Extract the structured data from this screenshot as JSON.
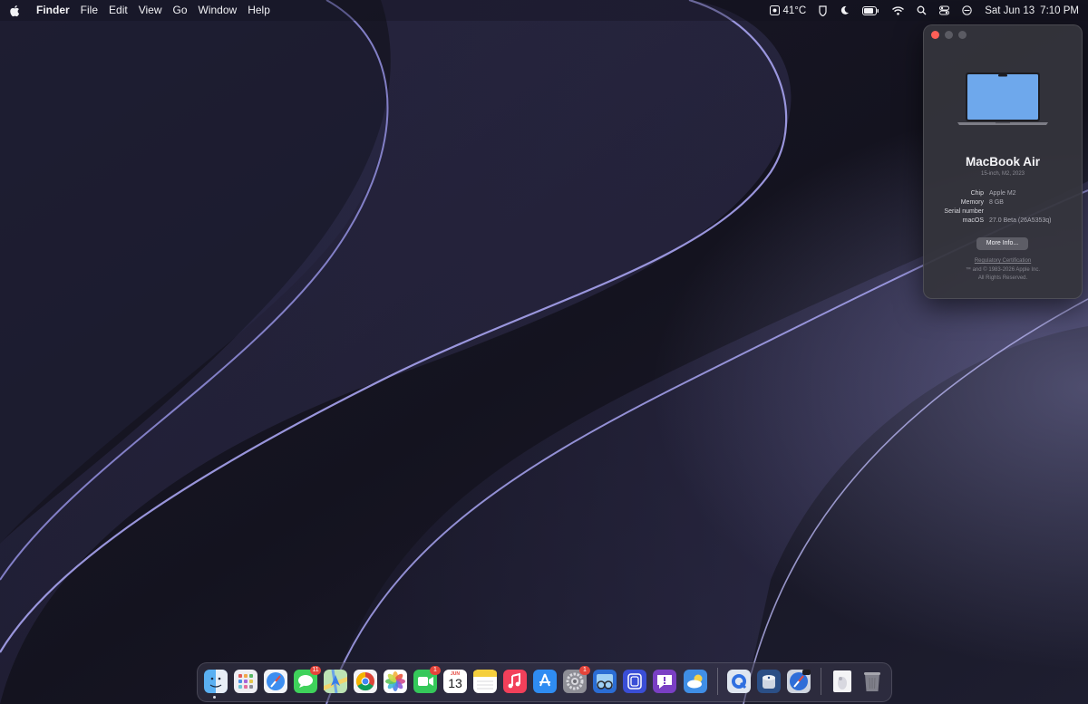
{
  "menubar": {
    "apple_icon": "apple-logo-icon",
    "items": [
      "Finder",
      "File",
      "Edit",
      "View",
      "Go",
      "Window",
      "Help"
    ],
    "weather": "41°C",
    "date": "Sat Jun 13",
    "time": "7:10 PM",
    "status_icons": [
      "weather-icon",
      "battery-shield-icon",
      "moon-icon",
      "battery-icon",
      "wifi-icon",
      "search-icon",
      "control-center-icon",
      "user-switch-icon"
    ]
  },
  "about": {
    "product_name": "MacBook Air",
    "product_subtitle": "15-inch, M2, 2023",
    "specs": [
      {
        "label": "Chip",
        "value": "Apple M2"
      },
      {
        "label": "Memory",
        "value": "8 GB"
      },
      {
        "label": "Serial number",
        "value": ""
      },
      {
        "label": "macOS",
        "value": "27.0 Beta (26A5353q)"
      }
    ],
    "more_info_label": "More Info...",
    "regulatory_link": "Regulatory Certification",
    "copyright_line1": "™ and © 1983-2026 Apple Inc.",
    "copyright_line2": "All Rights Reserved."
  },
  "dock": {
    "apps": [
      {
        "name": "finder-icon",
        "badge": ""
      },
      {
        "name": "launchpad-icon",
        "badge": ""
      },
      {
        "name": "safari-icon",
        "badge": ""
      },
      {
        "name": "messages-icon",
        "badge": "11"
      },
      {
        "name": "maps-icon",
        "badge": ""
      },
      {
        "name": "chrome-icon",
        "badge": ""
      },
      {
        "name": "photos-icon",
        "badge": ""
      },
      {
        "name": "facetime-icon",
        "badge": "1"
      },
      {
        "name": "calendar-icon",
        "badge": "",
        "day": "13",
        "month": "JUN"
      },
      {
        "name": "notes-icon",
        "badge": ""
      },
      {
        "name": "music-icon",
        "badge": ""
      },
      {
        "name": "app-store-icon",
        "badge": ""
      },
      {
        "name": "system-settings-icon",
        "badge": "1"
      },
      {
        "name": "preview-icon",
        "badge": ""
      },
      {
        "name": "screen-time-icon",
        "badge": ""
      },
      {
        "name": "feedback-icon",
        "badge": ""
      },
      {
        "name": "weather-app-icon",
        "badge": ""
      },
      {
        "name": "quicktime-icon",
        "badge": ""
      },
      {
        "name": "disk-utility-icon",
        "badge": ""
      },
      {
        "name": "safari-technology-preview-icon",
        "badge": ""
      },
      {
        "name": "preview-document-icon",
        "badge": ""
      },
      {
        "name": "trash-icon",
        "badge": ""
      }
    ]
  },
  "colors": {
    "wallpaper_base": "#14131f",
    "accent_purple": "#8b86d6",
    "badge_red": "#e5443a",
    "close_red": "#ff5f57"
  }
}
